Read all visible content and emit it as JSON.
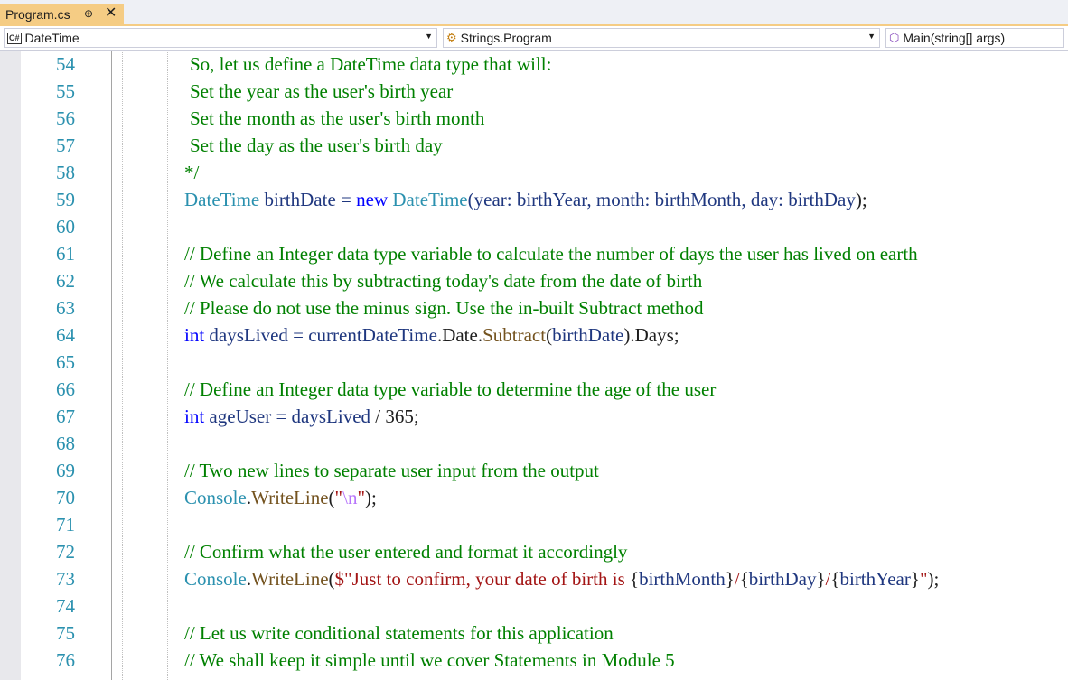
{
  "tab": {
    "label": "Program.cs",
    "pin_glyph": "⊕",
    "close_glyph": "✕",
    "accent_color": "#f5cc84"
  },
  "navbar": {
    "project_combo": {
      "icon": "csharp-file-icon",
      "icon_text": "C#",
      "value": "DateTime"
    },
    "type_combo": {
      "icon": "namespace-icon",
      "value": "Strings.Program"
    },
    "member_combo": {
      "icon": "method-icon",
      "value": "Main(string[] args)"
    }
  },
  "editor": {
    "lines": [
      {
        "num": "54",
        "indent": 6,
        "tokens": [
          {
            "t": "So, let us define a DateTime data type that will:",
            "c": "comment"
          }
        ]
      },
      {
        "num": "55",
        "indent": 6,
        "tokens": [
          {
            "t": "Set the year as the user's birth year",
            "c": "comment"
          }
        ]
      },
      {
        "num": "56",
        "indent": 6,
        "tokens": [
          {
            "t": "Set the month as the user's birth month",
            "c": "comment"
          }
        ]
      },
      {
        "num": "57",
        "indent": 6,
        "tokens": [
          {
            "t": "Set the day as the user's birth day",
            "c": "comment"
          }
        ]
      },
      {
        "num": "58",
        "indent": 0,
        "tokens": [
          {
            "t": "*/",
            "c": "comment"
          }
        ]
      },
      {
        "num": "59",
        "indent": 0,
        "tokens": [
          {
            "t": "DateTime",
            "c": "type"
          },
          {
            "t": " birthDate = ",
            "c": "ident"
          },
          {
            "t": "new",
            "c": "kw"
          },
          {
            "t": " ",
            "c": "plain"
          },
          {
            "t": "DateTime",
            "c": "type"
          },
          {
            "t": "(year: ",
            "c": "ident"
          },
          {
            "t": "birthYear",
            "c": "ident"
          },
          {
            "t": ", month: ",
            "c": "ident"
          },
          {
            "t": "birthMonth",
            "c": "ident"
          },
          {
            "t": ", day: ",
            "c": "ident"
          },
          {
            "t": "birthDay",
            "c": "ident"
          },
          {
            "t": ");",
            "c": "plain"
          }
        ]
      },
      {
        "num": "60",
        "indent": 0,
        "tokens": []
      },
      {
        "num": "61",
        "indent": 0,
        "tokens": [
          {
            "t": "// Define an Integer data type variable to calculate the number of days the user has lived on earth",
            "c": "comment"
          }
        ]
      },
      {
        "num": "62",
        "indent": 0,
        "tokens": [
          {
            "t": "// We calculate this by subtracting today's date from the date of birth",
            "c": "comment"
          }
        ]
      },
      {
        "num": "63",
        "indent": 0,
        "tokens": [
          {
            "t": "// Please do not use the minus sign. Use the in-built Subtract method",
            "c": "comment"
          }
        ]
      },
      {
        "num": "64",
        "indent": 0,
        "tokens": [
          {
            "t": "int",
            "c": "kw"
          },
          {
            "t": " daysLived = currentDateTime",
            "c": "ident"
          },
          {
            "t": ".Date.",
            "c": "plain"
          },
          {
            "t": "Subtract",
            "c": "method"
          },
          {
            "t": "(",
            "c": "plain"
          },
          {
            "t": "birthDate",
            "c": "ident"
          },
          {
            "t": ").Days;",
            "c": "plain"
          }
        ]
      },
      {
        "num": "65",
        "indent": 0,
        "tokens": []
      },
      {
        "num": "66",
        "indent": 0,
        "tokens": [
          {
            "t": "// Define an Integer data type variable to determine the age of the user",
            "c": "comment"
          }
        ]
      },
      {
        "num": "67",
        "indent": 0,
        "tokens": [
          {
            "t": "int",
            "c": "kw"
          },
          {
            "t": " ageUser = daysLived",
            "c": "ident"
          },
          {
            "t": " / 365;",
            "c": "plain"
          }
        ]
      },
      {
        "num": "68",
        "indent": 0,
        "tokens": []
      },
      {
        "num": "69",
        "indent": 0,
        "tokens": [
          {
            "t": "// Two new lines to separate user input from the output",
            "c": "comment"
          }
        ]
      },
      {
        "num": "70",
        "indent": 0,
        "tokens": [
          {
            "t": "Console",
            "c": "type"
          },
          {
            "t": ".",
            "c": "plain"
          },
          {
            "t": "WriteLine",
            "c": "method"
          },
          {
            "t": "(",
            "c": "plain"
          },
          {
            "t": "\"",
            "c": "string"
          },
          {
            "t": "\\n",
            "c": "escape"
          },
          {
            "t": "\"",
            "c": "string"
          },
          {
            "t": ");",
            "c": "plain"
          }
        ]
      },
      {
        "num": "71",
        "indent": 0,
        "tokens": []
      },
      {
        "num": "72",
        "indent": 0,
        "tokens": [
          {
            "t": "// Confirm what the user entered and format it accordingly",
            "c": "comment"
          }
        ]
      },
      {
        "num": "73",
        "indent": 0,
        "tokens": [
          {
            "t": "Console",
            "c": "type"
          },
          {
            "t": ".",
            "c": "plain"
          },
          {
            "t": "WriteLine",
            "c": "method"
          },
          {
            "t": "(",
            "c": "plain"
          },
          {
            "t": "$\"Just to confirm, your date of birth is ",
            "c": "string"
          },
          {
            "t": "{",
            "c": "plain"
          },
          {
            "t": "birthMonth",
            "c": "interp"
          },
          {
            "t": "}",
            "c": "plain"
          },
          {
            "t": "/",
            "c": "string"
          },
          {
            "t": "{",
            "c": "plain"
          },
          {
            "t": "birthDay",
            "c": "interp"
          },
          {
            "t": "}",
            "c": "plain"
          },
          {
            "t": "/",
            "c": "string"
          },
          {
            "t": "{",
            "c": "plain"
          },
          {
            "t": "birthYear",
            "c": "interp"
          },
          {
            "t": "}",
            "c": "plain"
          },
          {
            "t": "\"",
            "c": "string"
          },
          {
            "t": ");",
            "c": "plain"
          }
        ]
      },
      {
        "num": "74",
        "indent": 0,
        "tokens": []
      },
      {
        "num": "75",
        "indent": 0,
        "tokens": [
          {
            "t": "// Let us write conditional statements for this application",
            "c": "comment"
          }
        ]
      },
      {
        "num": "76",
        "indent": 0,
        "tokens": [
          {
            "t": "// We shall keep it simple until we cover Statements in Module 5",
            "c": "comment"
          }
        ]
      }
    ]
  }
}
